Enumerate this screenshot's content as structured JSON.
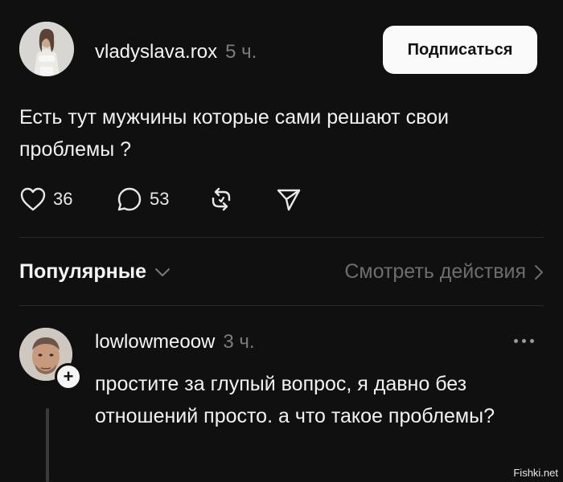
{
  "post": {
    "username": "vladyslava.rox",
    "time": "5 ч.",
    "follow_label": "Подписаться",
    "text": "Есть тут мужчины которые сами решают свои проблемы ?",
    "likes": "36",
    "replies": "53"
  },
  "sort": {
    "label": "Популярные",
    "view_activity": "Смотреть действия"
  },
  "comment": {
    "username": "lowlowmeoow",
    "time": "3 ч.",
    "plus": "+",
    "text": "простите за глупый вопрос, я давно без отношений просто. а что такое проблемы?"
  },
  "watermark": "Fishki.net",
  "icons": [
    "heart-icon",
    "comment-icon",
    "repost-icon",
    "share-icon",
    "chevron-down-icon",
    "chevron-right-icon",
    "more-icon"
  ],
  "colors": {
    "background": "#101010",
    "text": "#f2f2f2",
    "muted": "#7c7c7c",
    "button_bg": "#fafafa"
  }
}
